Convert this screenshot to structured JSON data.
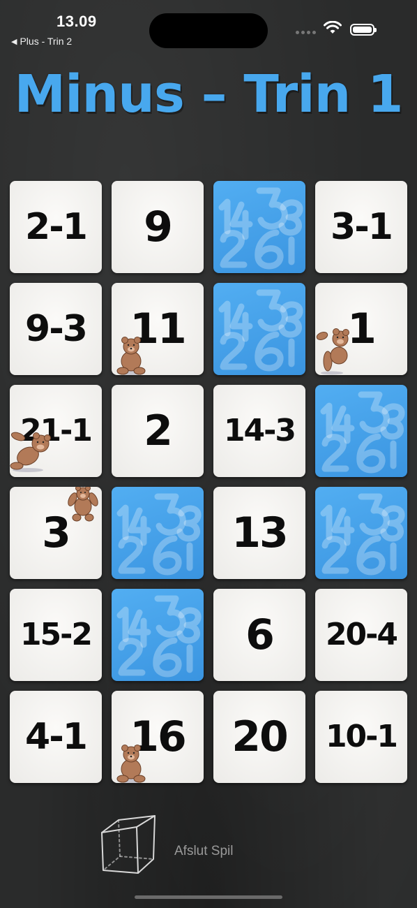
{
  "status": {
    "time": "13.09",
    "back_label": "Plus - Trin 2"
  },
  "title": "Minus – Trin 1",
  "cards": [
    {
      "label": "2-1",
      "state": "face"
    },
    {
      "label": "9",
      "state": "face"
    },
    {
      "label": "",
      "state": "back"
    },
    {
      "label": "3-1",
      "state": "face"
    },
    {
      "label": "9-3",
      "state": "face"
    },
    {
      "label": "11",
      "state": "face",
      "bear": "sitting"
    },
    {
      "label": "",
      "state": "back"
    },
    {
      "label": "1",
      "state": "face",
      "bear": "waving"
    },
    {
      "label": "21-1",
      "state": "face",
      "bear": "lying"
    },
    {
      "label": "2",
      "state": "face"
    },
    {
      "label": "14-3",
      "state": "face"
    },
    {
      "label": "",
      "state": "back"
    },
    {
      "label": "3",
      "state": "face",
      "bear": "hanging"
    },
    {
      "label": "",
      "state": "back"
    },
    {
      "label": "13",
      "state": "face"
    },
    {
      "label": "",
      "state": "back"
    },
    {
      "label": "15-2",
      "state": "face"
    },
    {
      "label": "",
      "state": "back"
    },
    {
      "label": "6",
      "state": "face"
    },
    {
      "label": "20-4",
      "state": "face"
    },
    {
      "label": "4-1",
      "state": "face"
    },
    {
      "label": "16",
      "state": "face",
      "bear": "sitting"
    },
    {
      "label": "20",
      "state": "face"
    },
    {
      "label": "10-1",
      "state": "face"
    }
  ],
  "footer": {
    "quit_label": "Afslut Spil",
    "icon": "chalk-cube-icon"
  },
  "colors": {
    "title": "#48a8ee",
    "card_back": "#3a9ae6",
    "card_face": "#f6f5f3",
    "background": "#2a2b2b"
  }
}
